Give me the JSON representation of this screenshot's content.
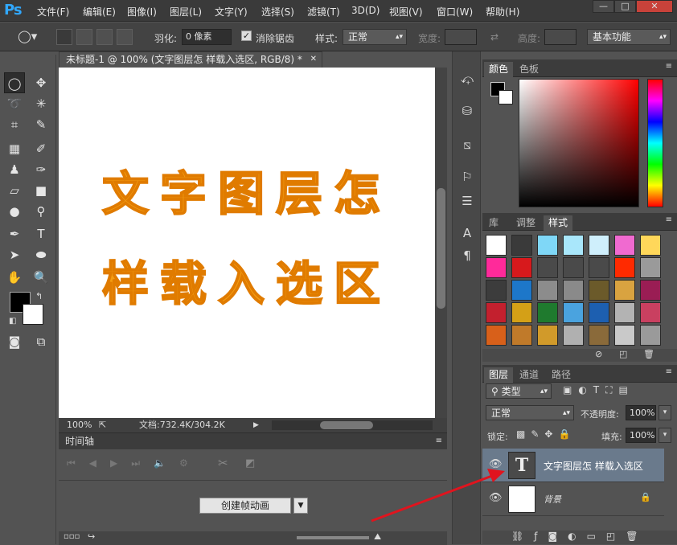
{
  "app": {
    "logo": "Ps"
  },
  "menu": [
    "文件(F)",
    "编辑(E)",
    "图像(I)",
    "图层(L)",
    "文字(Y)",
    "选择(S)",
    "滤镜(T)",
    "3D(D)",
    "视图(V)",
    "窗口(W)",
    "帮助(H)"
  ],
  "window_buttons": {
    "minimize": "—",
    "maximize": "□",
    "close": "✕"
  },
  "options": {
    "feather_label": "羽化:",
    "feather_value": "0 像素",
    "antialias_label": "消除锯齿",
    "style_label": "样式:",
    "style_value": "正常",
    "width_label": "宽度:",
    "height_label": "高度:",
    "workspace": "基本功能"
  },
  "document": {
    "tab_title": "未标题-1 @ 100% (文字图层怎 样载入选区, RGB/8) *",
    "tab_close": "✕",
    "line1": "文字图层怎",
    "line2": "样载入选区",
    "zoom": "100%",
    "doc_info": "文档:732.4K/304.2K"
  },
  "timeline": {
    "title": "时间轴",
    "create_button": "创建帧动画"
  },
  "color_panel": {
    "tabs": [
      "颜色",
      "色板"
    ],
    "fg": "#000000",
    "bg": "#ffffff"
  },
  "styles_panel": {
    "tabs": [
      "库",
      "调整",
      "样式"
    ],
    "swatches": [
      "#ffffff",
      "#3a3a3a",
      "#7fd7f7",
      "#a9e7fb",
      "#cfeffc",
      "#f06ad0",
      "#ffd75a",
      "#ff2a9a",
      "#d7191c",
      "#4a4a4a",
      "#4a4a4a",
      "#4a4a4a",
      "#ff2a00",
      "#9a9a9a",
      "#3c3c3c",
      "#1d77c9",
      "#8c8c8c",
      "#8a8a8a",
      "#6b5a2a",
      "#d9a340",
      "#9a1d54",
      "#c3202e",
      "#d4a017",
      "#1f7a2e",
      "#4aa3df",
      "#1d5fb0",
      "#b3b3b3",
      "#c94060",
      "#d8601a",
      "#c07a2a",
      "#d19a2a",
      "#b0b0b0",
      "#8a6a3a",
      "#c9c9c9",
      "#9a9a9a"
    ]
  },
  "layers_panel": {
    "tabs": [
      "图层",
      "通道",
      "路径"
    ],
    "filter": "类型",
    "blend": "正常",
    "opacity_label": "不透明度:",
    "opacity": "100%",
    "lock_label": "锁定:",
    "fill_label": "填充:",
    "fill": "100%",
    "layers": [
      {
        "name": "文字图层怎 样载入选区",
        "thumb": "T",
        "selected": true
      },
      {
        "name": "背景",
        "thumb": "",
        "selected": false
      }
    ]
  },
  "colors": {
    "accent": "#31a8ff",
    "text_fill": "#f39c12",
    "arrow": "#e0141e"
  }
}
